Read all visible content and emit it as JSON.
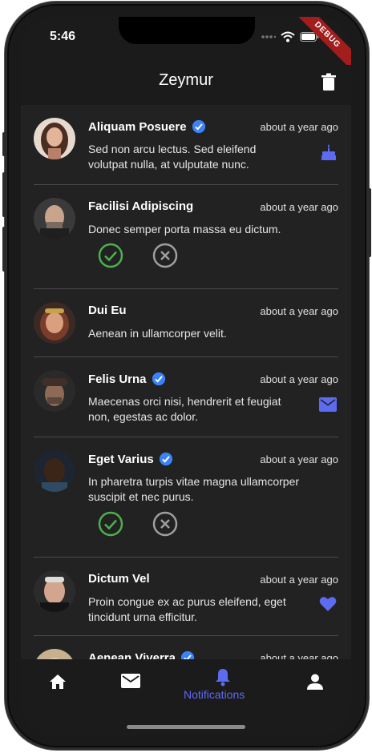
{
  "status_bar": {
    "time": "5:46",
    "debug_label": "DEBUG"
  },
  "app_bar": {
    "title": "Zeymur"
  },
  "notifications": [
    {
      "name": "Aliquam Posuere",
      "verified": true,
      "time": "about a year ago",
      "message": "Sed non arcu lectus. Sed eleifend volutpat nulla, at vulputate nunc.",
      "trailing_icon": "cake-icon",
      "actions": false
    },
    {
      "name": "Facilisi Adipiscing",
      "verified": false,
      "time": "about a year ago",
      "message": "Donec semper porta massa eu dictum.",
      "trailing_icon": null,
      "actions": true
    },
    {
      "name": "Dui Eu",
      "verified": false,
      "time": "about a year ago",
      "message": "Aenean in ullamcorper velit.",
      "trailing_icon": null,
      "actions": false
    },
    {
      "name": "Felis Urna",
      "verified": true,
      "time": "about a year ago",
      "message": "Maecenas orci nisi, hendrerit et feugiat non, egestas ac dolor.",
      "trailing_icon": "mail-icon",
      "actions": false
    },
    {
      "name": "Eget Varius",
      "verified": true,
      "time": "about a year ago",
      "message": "In pharetra turpis vitae magna ullamcorper suscipit et nec purus.",
      "trailing_icon": null,
      "actions": true
    },
    {
      "name": "Dictum Vel",
      "verified": false,
      "time": "about a year ago",
      "message": "Proin congue ex ac purus eleifend, eget tincidunt urna efficitur.",
      "trailing_icon": "heart-icon",
      "actions": false
    },
    {
      "name": "Aenean Viverra",
      "verified": true,
      "time": "about a year ago",
      "message": "",
      "trailing_icon": null,
      "actions": false
    }
  ],
  "bottom_nav": {
    "items": [
      "home-icon",
      "mail-icon",
      "bell-icon",
      "person-icon"
    ],
    "selected_label": "Notifications"
  },
  "colors": {
    "accent": "#5c6bf0",
    "verified": "#3b82f6",
    "accept": "#4caf50",
    "reject": "#9e9e9e",
    "background": "#222222"
  }
}
